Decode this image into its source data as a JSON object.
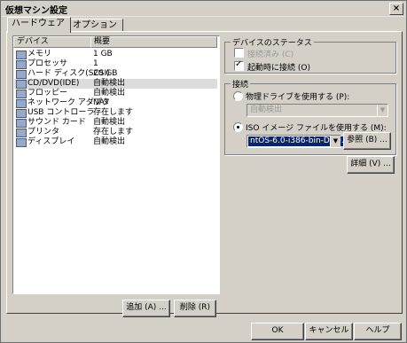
{
  "window": {
    "title": "仮想マシン設定",
    "close_glyph": "×"
  },
  "tabs": [
    {
      "label": "ハードウェア"
    },
    {
      "label": "オプション"
    }
  ],
  "device_list": {
    "columns": [
      "デバイス",
      "概要"
    ],
    "rows": [
      {
        "device": "メモリ",
        "summary": "1 GB",
        "icon": "memory-icon"
      },
      {
        "device": "プロセッサ",
        "summary": "1",
        "icon": "processor-icon"
      },
      {
        "device": "ハード ディスク(SCSI)",
        "summary": "20 GB",
        "icon": "hard-disk-icon"
      },
      {
        "device": "CD/DVD(IDE)",
        "summary": "自動検出",
        "icon": "cd-dvd-icon",
        "selected": true
      },
      {
        "device": "フロッピー",
        "summary": "自動検出",
        "icon": "floppy-icon"
      },
      {
        "device": "ネットワーク アダプタ",
        "summary": "NAT",
        "icon": "network-adapter-icon"
      },
      {
        "device": "USB コントローラ",
        "summary": "存在します",
        "icon": "usb-icon"
      },
      {
        "device": "サウンド カード",
        "summary": "自動検出",
        "icon": "sound-card-icon"
      },
      {
        "device": "プリンタ",
        "summary": "存在します",
        "icon": "printer-icon"
      },
      {
        "device": "ディスプレイ",
        "summary": "自動検出",
        "icon": "display-icon"
      }
    ]
  },
  "list_buttons": {
    "add": "追加 (A) ...",
    "remove": "削除 (R)"
  },
  "device_status": {
    "title": "デバイスのステータス",
    "connected": "接続済み (C)",
    "connect_at_power_on": "起動時に接続 (O)"
  },
  "connection": {
    "title": "接続",
    "physical_drive": "物理ドライブを使用する (P):",
    "physical_value": "自動検出",
    "iso_image": "ISO イメージ ファイルを使用する (M):",
    "iso_value": "ntOS-6.0-i386-bin-DVD.iso",
    "browse": "参照 (B) ..."
  },
  "advanced_button": "詳細 (V) ...",
  "footer": {
    "ok": "OK",
    "cancel": "キャンセル",
    "help": "ヘルプ"
  }
}
